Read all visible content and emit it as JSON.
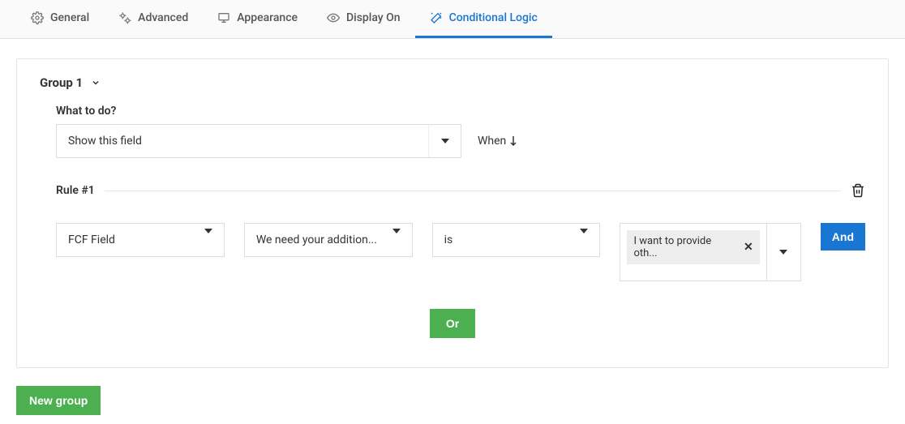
{
  "tabs": {
    "general": {
      "label": "General"
    },
    "advanced": {
      "label": "Advanced"
    },
    "appearance": {
      "label": "Appearance"
    },
    "display_on": {
      "label": "Display On"
    },
    "conditional_logic": {
      "label": "Conditional Logic"
    }
  },
  "group": {
    "title": "Group 1",
    "what_to_do_label": "What to do?",
    "action_value": "Show this field",
    "when_label": "When"
  },
  "rule": {
    "title": "Rule #1",
    "field_type": "FCF Field",
    "field_value": "We need your addition...",
    "operator": "is",
    "tag_value": "I want to provide oth..."
  },
  "buttons": {
    "and": "And",
    "or": "Or",
    "new_group": "New group"
  }
}
